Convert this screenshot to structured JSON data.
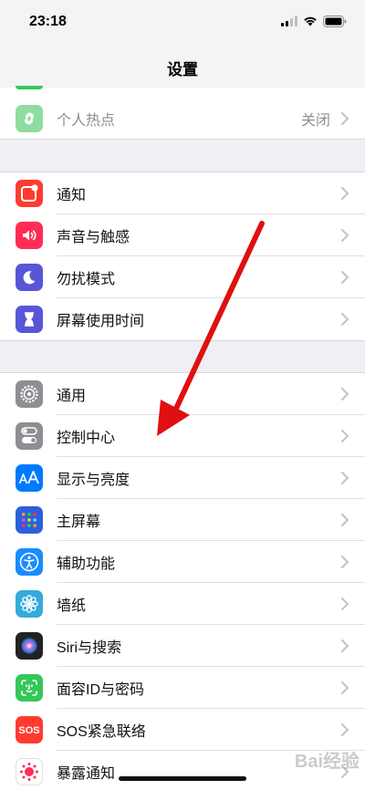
{
  "status_bar": {
    "time": "23:18"
  },
  "nav": {
    "title": "设置"
  },
  "groups": [
    {
      "items": [
        {
          "label": "个人热点",
          "value": "关闭",
          "icon": "hotspot-icon",
          "color": "#34c759"
        }
      ]
    },
    {
      "items": [
        {
          "label": "通知",
          "icon": "notification-icon",
          "color": "#ff3b30"
        },
        {
          "label": "声音与触感",
          "icon": "speaker-icon",
          "color": "#ff2d55"
        },
        {
          "label": "勿扰模式",
          "icon": "moon-icon",
          "color": "#5856d6"
        },
        {
          "label": "屏幕使用时间",
          "icon": "hourglass-icon",
          "color": "#5856d6"
        }
      ]
    },
    {
      "items": [
        {
          "label": "通用",
          "icon": "gear-icon",
          "color": "#8e8e93"
        },
        {
          "label": "控制中心",
          "icon": "toggle-icon",
          "color": "#8e8e93"
        },
        {
          "label": "显示与亮度",
          "icon": "text-size-icon",
          "color": "#007aff"
        },
        {
          "label": "主屏幕",
          "icon": "home-grid-icon",
          "color": "#2c5fdb"
        },
        {
          "label": "辅助功能",
          "icon": "accessibility-icon",
          "color": "#1a8cff"
        },
        {
          "label": "墙纸",
          "icon": "flower-icon",
          "color": "#35aadc"
        },
        {
          "label": "Siri与搜索",
          "icon": "siri-icon",
          "color": "#222222"
        },
        {
          "label": "面容ID与密码",
          "icon": "face-id-icon",
          "color": "#34c759"
        },
        {
          "label": "SOS紧急联络",
          "icon": "sos-icon",
          "color": "#ff3b30"
        },
        {
          "label": "暴露通知",
          "icon": "exposure-icon",
          "color": "#ffffff"
        }
      ]
    }
  ],
  "watermark": "Bai经验"
}
